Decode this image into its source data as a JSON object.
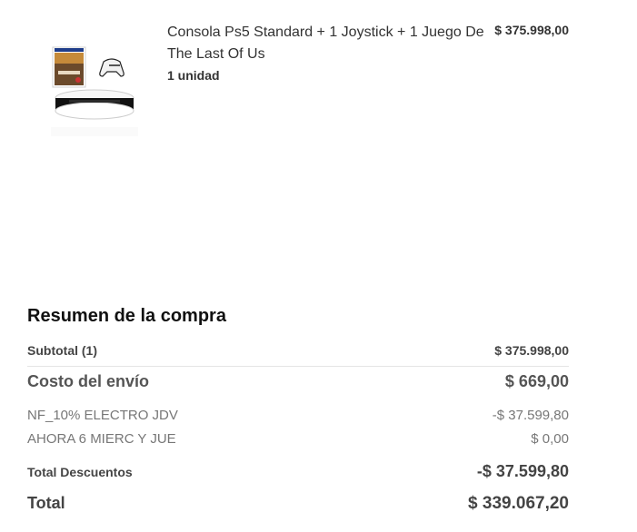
{
  "product": {
    "title": "Consola Ps5 Standard + 1 Joystick + 1 Juego De The Last Of Us",
    "quantity": "1 unidad",
    "price": "$ 375.998,00",
    "image": "ps5-bundle-image"
  },
  "summary": {
    "title": "Resumen de la compra",
    "subtotal_label": "Subtotal (1)",
    "subtotal_value": "$ 375.998,00",
    "shipping_label": "Costo del envío",
    "shipping_value": "$ 669,00",
    "discounts": [
      {
        "label": "NF_10% ELECTRO JDV",
        "value": "-$ 37.599,80"
      },
      {
        "label": "AHORA 6 MIERC Y JUE",
        "value": "$ 0,00"
      }
    ],
    "total_discounts_label": "Total Descuentos",
    "total_discounts_value": "-$ 37.599,80",
    "total_label": "Total",
    "total_value": "$ 339.067,20"
  }
}
